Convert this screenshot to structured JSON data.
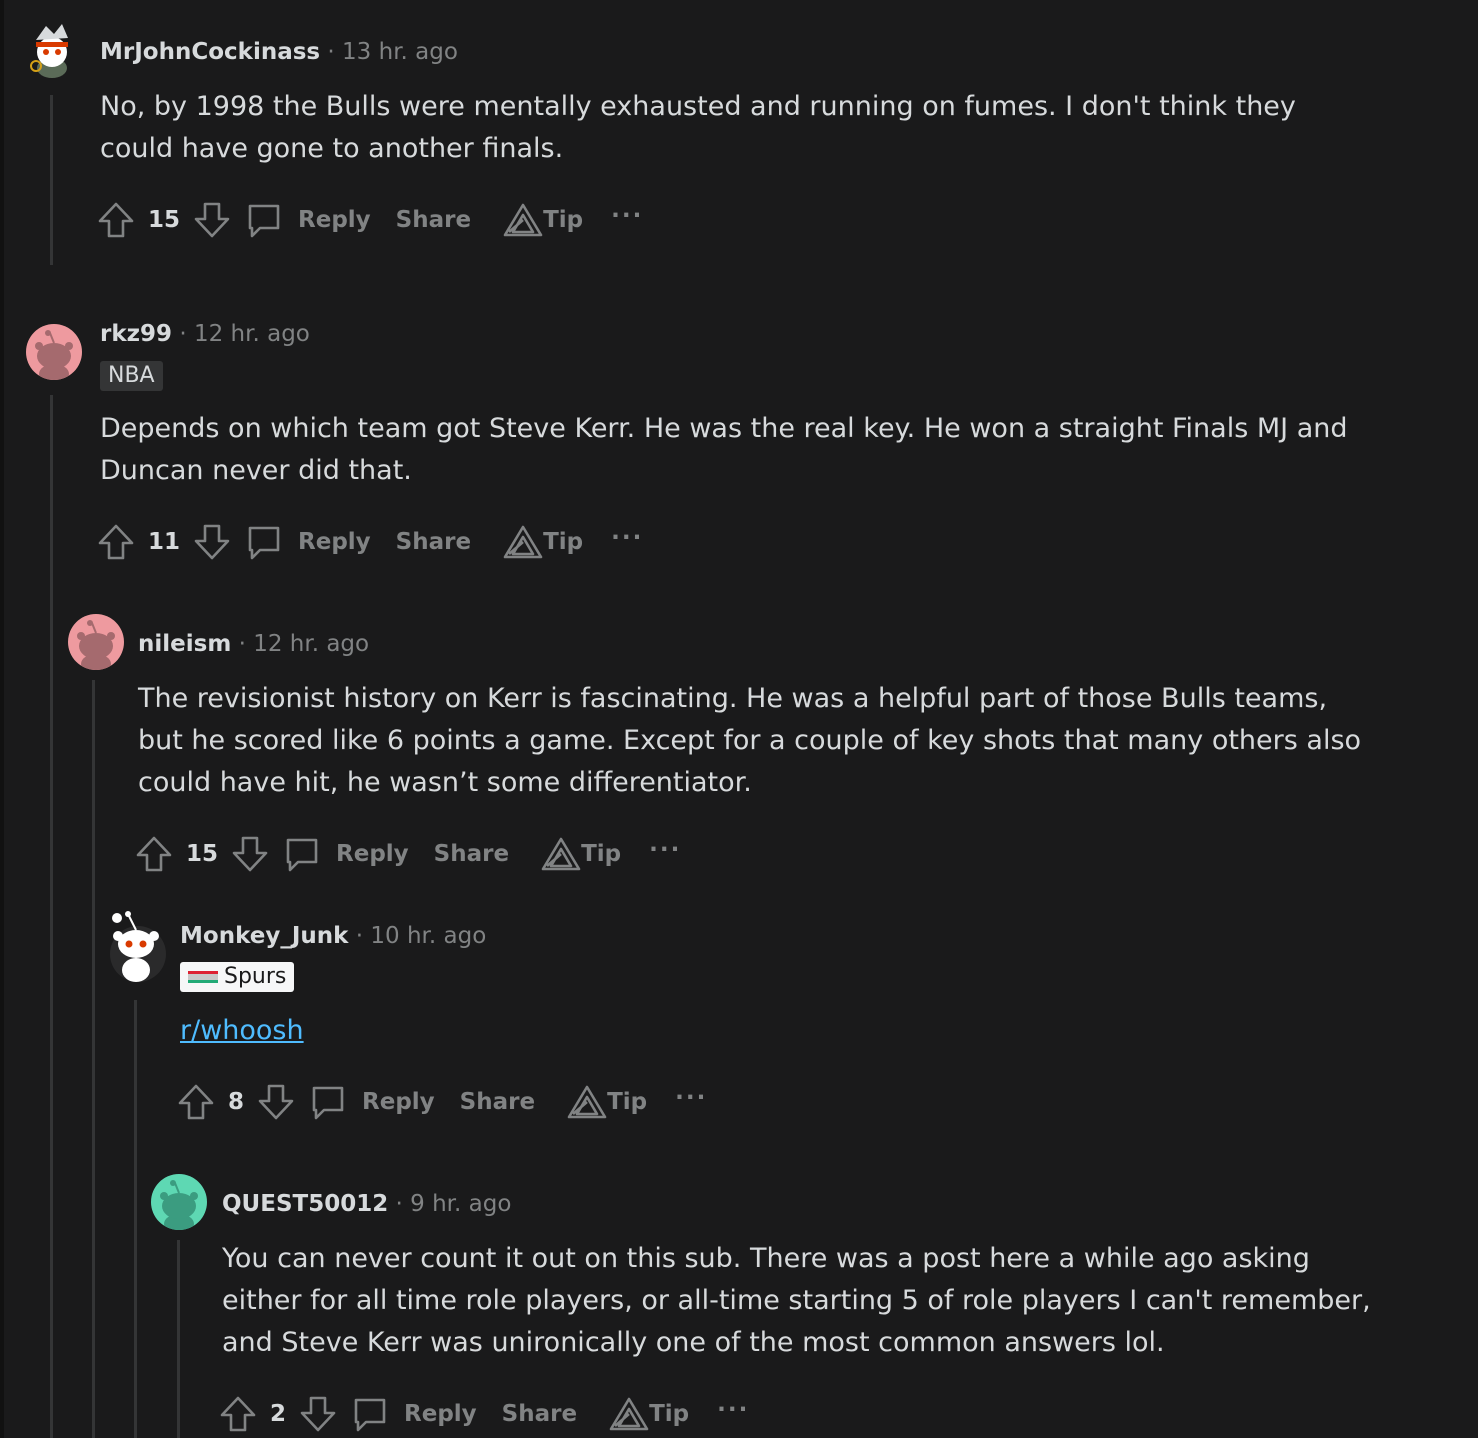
{
  "comments": [
    {
      "user": "MrJohnCockinass",
      "time": "13 hr. ago",
      "flair": null,
      "body": "No, by 1998 the Bulls were mentally exhausted and running on fumes. I don't think they could have gone to another finals.",
      "score": "15"
    },
    {
      "user": "rkz99",
      "time": "12 hr. ago",
      "flair": "NBA",
      "body": "Depends on which team got Steve Kerr. He was the real key. He won a straight Finals MJ and Duncan never did that.",
      "score": "11"
    },
    {
      "user": "nileism",
      "time": "12 hr. ago",
      "flair": null,
      "body": "The revisionist history on Kerr is fascinating. He was a helpful part of those Bulls teams, but he scored like 6 points a game. Except for a couple of key shots that many others also could have hit, he wasn’t some differentiator.",
      "score": "15"
    },
    {
      "user": "Monkey_Junk",
      "time": "10 hr. ago",
      "flair": "Spurs",
      "body_link": "r/whoosh",
      "score": "8"
    },
    {
      "user": "QUEST50012",
      "time": "9 hr. ago",
      "flair": null,
      "body": "You can never count it out on this sub. There was a post here a while ago asking either for all time role players, or all-time starting 5 of role players I can't remember, and Steve Kerr was unironically one of the most common answers lol.",
      "score": "2"
    }
  ],
  "labels": {
    "dot": "·",
    "reply": "Reply",
    "share": "Share",
    "tip": "Tip",
    "more": "···"
  },
  "icons": {
    "upvote": "upvote-arrow-icon",
    "downvote": "downvote-arrow-icon",
    "reply": "speech-bubble-icon",
    "tip": "triangle-award-icon",
    "more": "ellipsis-icon"
  },
  "colors": {
    "background": "#1a1a1b",
    "text": "#d7dadc",
    "muted": "#818384",
    "link": "#4fbcff",
    "avatar_pink": "#ee9a9f",
    "avatar_teal": "#5ed8b3"
  }
}
